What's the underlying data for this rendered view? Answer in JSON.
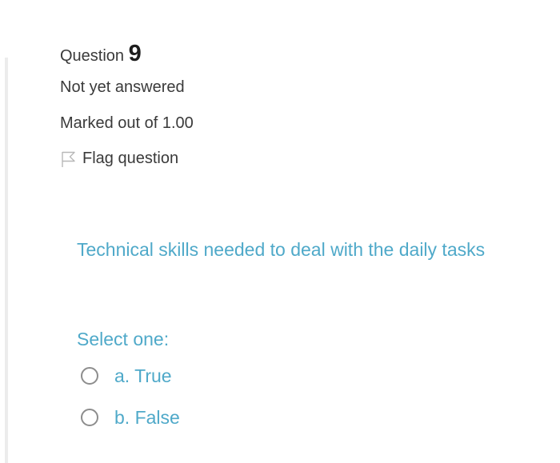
{
  "question": {
    "label": "Question",
    "number": "9",
    "state": "Not yet answered",
    "grade": "Marked out of 1.00",
    "flag_label": "Flag question",
    "text": "Technical skills needed to deal with the daily tasks",
    "prompt": "Select one:",
    "answers": [
      {
        "label": "a. True",
        "selected": false
      },
      {
        "label": "b. False",
        "selected": false
      }
    ]
  },
  "colors": {
    "accent": "#4fa9c9",
    "info_text": "#3a3a3a",
    "radio_border": "#8d8d8d",
    "rule": "#ececec"
  },
  "icons": {
    "flag": "flag-outline-icon"
  }
}
